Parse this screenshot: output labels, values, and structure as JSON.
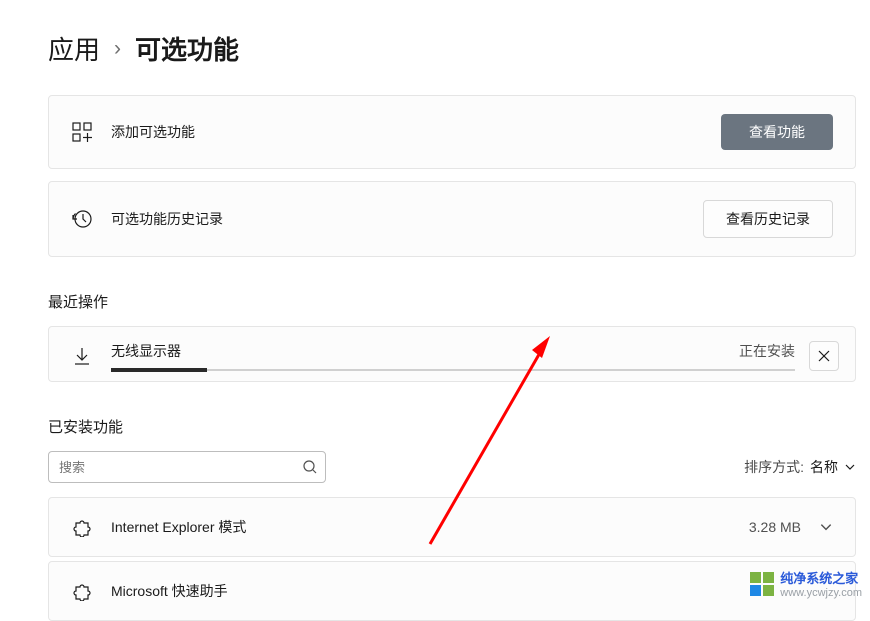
{
  "breadcrumb": {
    "parent": "应用",
    "separator": "›",
    "current": "可选功能"
  },
  "cards": {
    "add": {
      "label": "添加可选功能",
      "button": "查看功能"
    },
    "history": {
      "label": "可选功能历史记录",
      "button": "查看历史记录"
    }
  },
  "recent": {
    "title": "最近操作",
    "item": {
      "name": "无线显示器",
      "status": "正在安装"
    }
  },
  "installed": {
    "title": "已安装功能",
    "search_placeholder": "搜索",
    "sort_label": "排序方式:",
    "sort_value": "名称",
    "items": [
      {
        "name": "Internet Explorer 模式",
        "size": "3.28 MB"
      },
      {
        "name": "Microsoft 快速助手",
        "size": ""
      }
    ]
  },
  "watermark": {
    "main": "纯净系统之家",
    "sub": "www.ycwjzy.com"
  }
}
